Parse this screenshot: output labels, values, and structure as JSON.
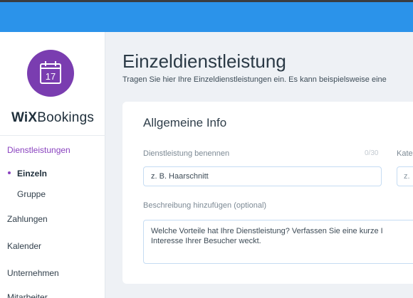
{
  "brand": {
    "wix": "WiX",
    "bookings": "Bookings",
    "calendar_day": "17"
  },
  "sidebar": {
    "services": "Dienstleistungen",
    "single": "Einzeln",
    "group": "Gruppe",
    "payments": "Zahlungen",
    "calendar": "Kalender",
    "company": "Unternehmen",
    "staff": "Mitarbeiter"
  },
  "main": {
    "title": "Einzeldienstleistung",
    "subtitle": "Tragen Sie hier Ihre Einzeldienstleistungen ein. Es kann beispielsweise eine"
  },
  "card": {
    "title": "Allgemeine Info",
    "name_label": "Dienstleistung benennen",
    "name_counter": "0/30",
    "name_placeholder": "z. B. Haarschnitt",
    "category_label": "Kate",
    "category_placeholder": "z.",
    "description_label": "Beschreibung hinzufügen (optional)",
    "description_line1": "Welche Vorteile hat Ihre Dienstleistung? Verfassen Sie eine kurze I",
    "description_line2": "Interesse Ihrer Besucher weckt."
  },
  "colors": {
    "topbar": "#2b93ea",
    "accent": "#8a43bf",
    "logo": "#7a3db0"
  }
}
